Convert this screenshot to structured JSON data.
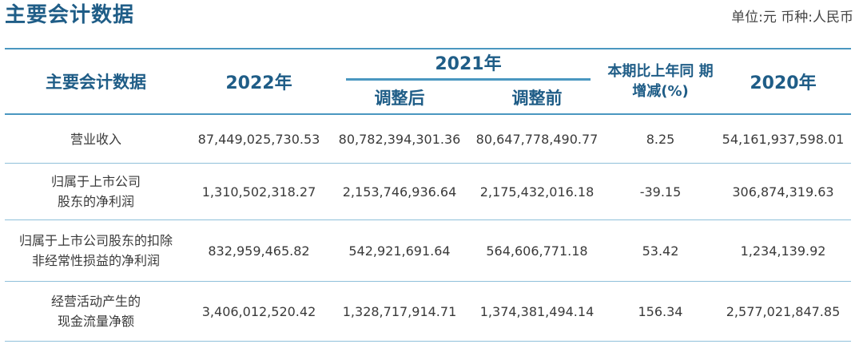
{
  "header": {
    "title": "主要会计数据",
    "unit": "单位:元  币种:人民币"
  },
  "table": {
    "col_item": "主要会计数据",
    "col_2022": "2022年",
    "col_2021": "2021年",
    "col_2021_adjusted": "调整后",
    "col_2021_before": "调整前",
    "col_change_line1": "本期比上年同",
    "col_change_line2": "期增减(%)",
    "col_2020": "2020年",
    "rows": [
      {
        "label_line1": "营业收入",
        "label_line2": "",
        "v2022": "87,449,025,730.53",
        "v2021_adjusted": "80,782,394,301.36",
        "v2021_before": "80,647,778,490.77",
        "change": "8.25",
        "v2020": "54,161,937,598.01"
      },
      {
        "label_line1": "归属于上市公司",
        "label_line2": "股东的净利润",
        "v2022": "1,310,502,318.27",
        "v2021_adjusted": "2,153,746,936.64",
        "v2021_before": "2,175,432,016.18",
        "change": "-39.15",
        "v2020": "306,874,319.63"
      },
      {
        "label_line1": "归属于上市公司股东的扣除",
        "label_line2": "非经常性损益的净利润",
        "v2022": "832,959,465.82",
        "v2021_adjusted": "542,921,691.64",
        "v2021_before": "564,606,771.18",
        "change": "53.42",
        "v2020": "1,234,139.92"
      },
      {
        "label_line1": "经营活动产生的",
        "label_line2": "现金流量净额",
        "v2022": "3,406,012,520.42",
        "v2021_adjusted": "1,328,717,914.71",
        "v2021_before": "1,374,381,494.14",
        "change": "156.34",
        "v2020": "2,577,021,847.85"
      }
    ]
  }
}
